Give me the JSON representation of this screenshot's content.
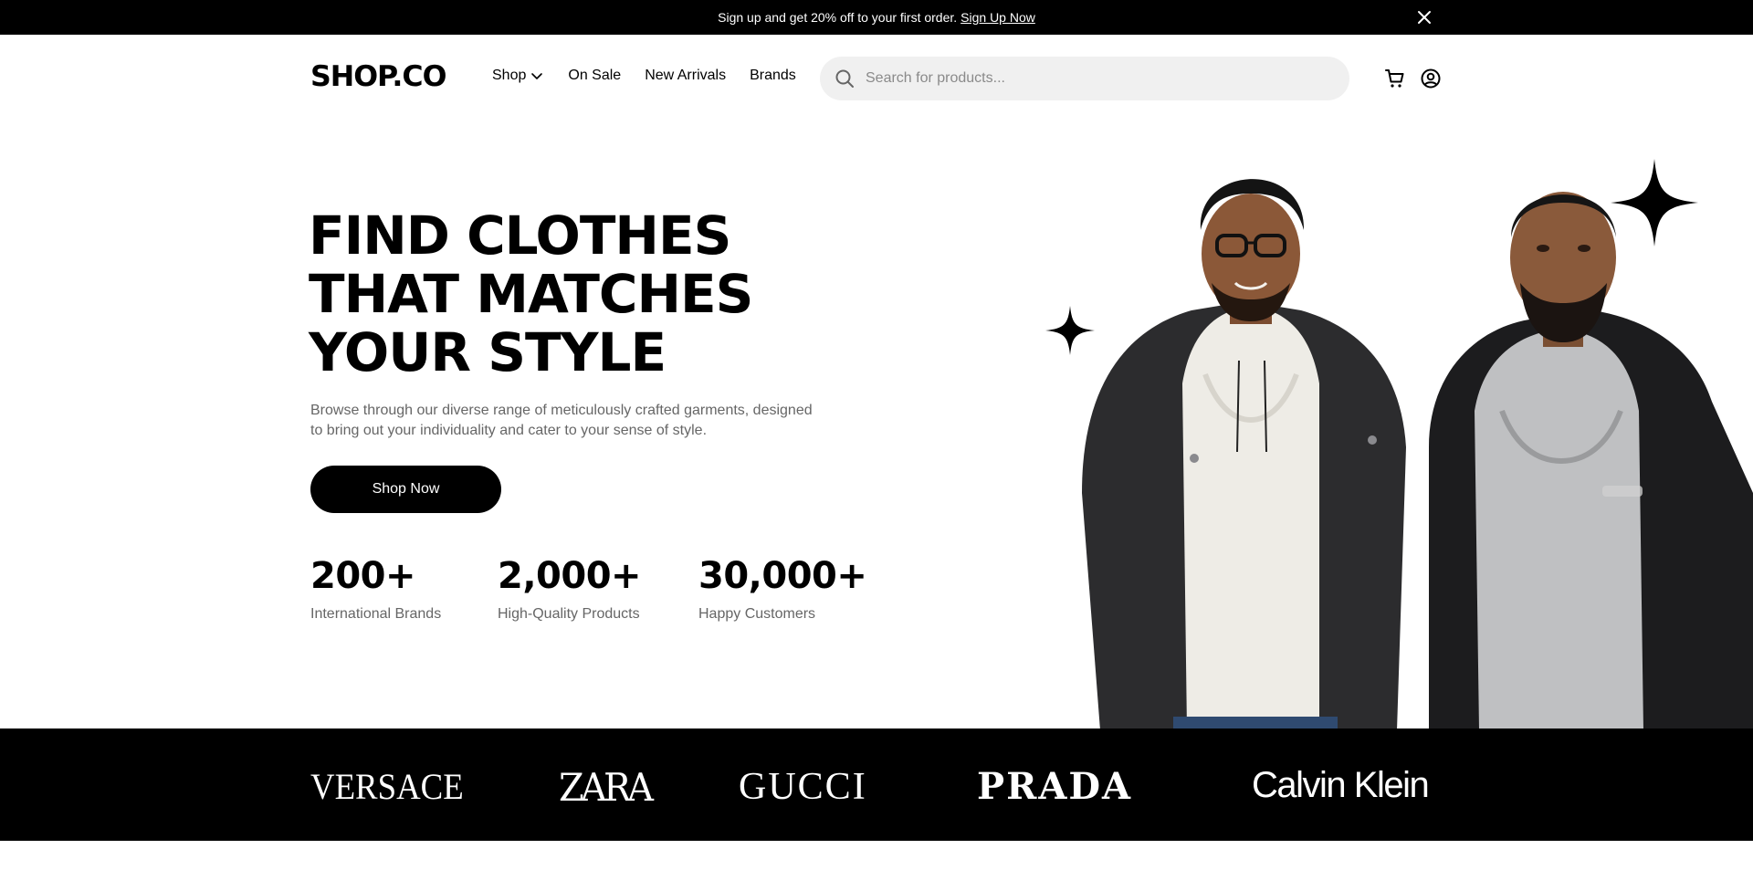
{
  "announcement": {
    "text": "Sign up and get 20% off to your first order.",
    "link_label": "Sign Up Now",
    "close_icon": "close-icon"
  },
  "header": {
    "logo": "SHOP.CO",
    "nav": [
      {
        "label": "Shop",
        "has_dropdown": true
      },
      {
        "label": "On Sale"
      },
      {
        "label": "New Arrivals"
      },
      {
        "label": "Brands"
      }
    ],
    "search": {
      "placeholder": "Search for products...",
      "value": "",
      "icon": "search-icon"
    },
    "cart_icon": "cart-icon",
    "account_icon": "user-icon"
  },
  "hero": {
    "title_lines": [
      "FIND CLOTHES",
      "THAT MATCHES",
      "YOUR STYLE"
    ],
    "description": "Browse through our diverse range of meticulously crafted garments, designed to bring out your individuality and cater to your sense of style.",
    "cta_label": "Shop Now",
    "stats": [
      {
        "value": "200+",
        "label": "International Brands"
      },
      {
        "value": "2,000+",
        "label": "High-Quality Products"
      },
      {
        "value": "30,000+",
        "label": "Happy Customers"
      }
    ]
  },
  "brands": [
    "VERSACE",
    "ZARA",
    "GUCCI",
    "PRADA",
    "Calvin Klein"
  ],
  "colors": {
    "primary": "#000000",
    "background": "#ffffff",
    "search_bg": "#f0f0f0",
    "muted_text": "#666666"
  }
}
